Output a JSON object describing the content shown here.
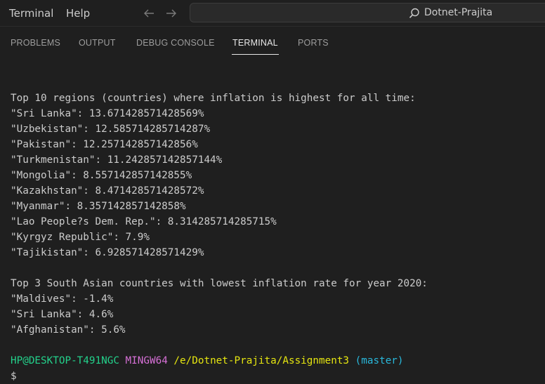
{
  "menu": {
    "items": [
      "Terminal",
      "Help"
    ]
  },
  "search": {
    "text": "Dotnet-Prajita"
  },
  "panel": {
    "tabs": [
      {
        "label": "PROBLEMS"
      },
      {
        "label": "OUTPUT"
      },
      {
        "label": "DEBUG CONSOLE"
      },
      {
        "label": "TERMINAL",
        "active": true
      },
      {
        "label": "PORTS"
      }
    ]
  },
  "terminal": {
    "lines": [
      "Top 10 regions (countries) where inflation is highest for all time:",
      "\"Sri Lanka\": 13.671428571428569%",
      "\"Uzbekistan\": 12.585714285714287%",
      "\"Pakistan\": 12.257142857142856%",
      "\"Turkmenistan\": 11.242857142857144%",
      "\"Mongolia\": 8.557142857142855%",
      "\"Kazakhstan\": 8.471428571428572%",
      "\"Myanmar\": 8.357142857142858%",
      "\"Lao People?s Dem. Rep.\": 8.314285714285715%",
      "\"Kyrgyz Republic\": 7.9%",
      "\"Tajikistan\": 6.928571428571429%",
      "",
      "Top 3 South Asian countries with lowest inflation rate for year 2020:",
      "\"Maldives\": -1.4%",
      "\"Sri Lanka\": 4.6%",
      "\"Afghanistan\": 5.6%"
    ],
    "prompt": {
      "user_host": "HP@DESKTOP-T491NGC",
      "system": "MINGW64",
      "path": "/e/Dotnet-Prajita/Assignment3",
      "branch": "(master)",
      "symbol": "$"
    }
  },
  "colors": {
    "background": "#1f1f1f",
    "text": "#cccccc",
    "prompt_user": "#23d18b",
    "prompt_system": "#d670d6",
    "prompt_path": "#e5e510",
    "prompt_branch": "#29b8db"
  }
}
